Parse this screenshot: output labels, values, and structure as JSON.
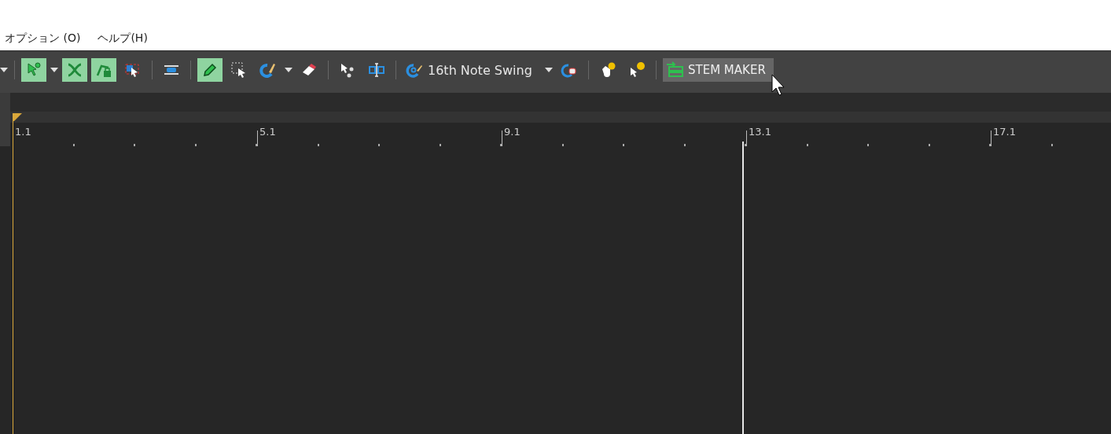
{
  "menu": [
    {
      "label": "オプション (O)"
    },
    {
      "label": "ヘルプ(H)"
    }
  ],
  "toolbar": [
    {
      "kind": "caret"
    },
    {
      "kind": "sep"
    },
    {
      "kind": "tool",
      "selected": true
    },
    {
      "kind": "caret"
    },
    {
      "kind": "tool",
      "selected": true
    },
    {
      "kind": "tool",
      "selected": true
    },
    {
      "kind": "tool",
      "selected": false
    },
    {
      "kind": "sep"
    },
    {
      "kind": "tool",
      "selected": false
    },
    {
      "kind": "sep"
    },
    {
      "kind": "tool",
      "selected": true
    },
    {
      "kind": "tool",
      "selected": false
    },
    {
      "kind": "tool",
      "selected": false
    },
    {
      "kind": "caret"
    },
    {
      "kind": "tool",
      "selected": false
    },
    {
      "kind": "sep"
    },
    {
      "kind": "tool",
      "selected": false
    },
    {
      "kind": "tool",
      "selected": false
    },
    {
      "kind": "sep"
    },
    {
      "kind": "groove",
      "label": "16th Note Swing"
    },
    {
      "kind": "caret"
    },
    {
      "kind": "tool",
      "selected": false
    },
    {
      "kind": "sep"
    },
    {
      "kind": "tool",
      "selected": false
    },
    {
      "kind": "tool",
      "selected": false
    },
    {
      "kind": "sep"
    },
    {
      "kind": "stem",
      "label": "STEM MAKER"
    }
  ],
  "ruler": {
    "labels": [
      "1.1",
      "5.1",
      "9.1",
      "13.1",
      "17.1"
    ]
  }
}
